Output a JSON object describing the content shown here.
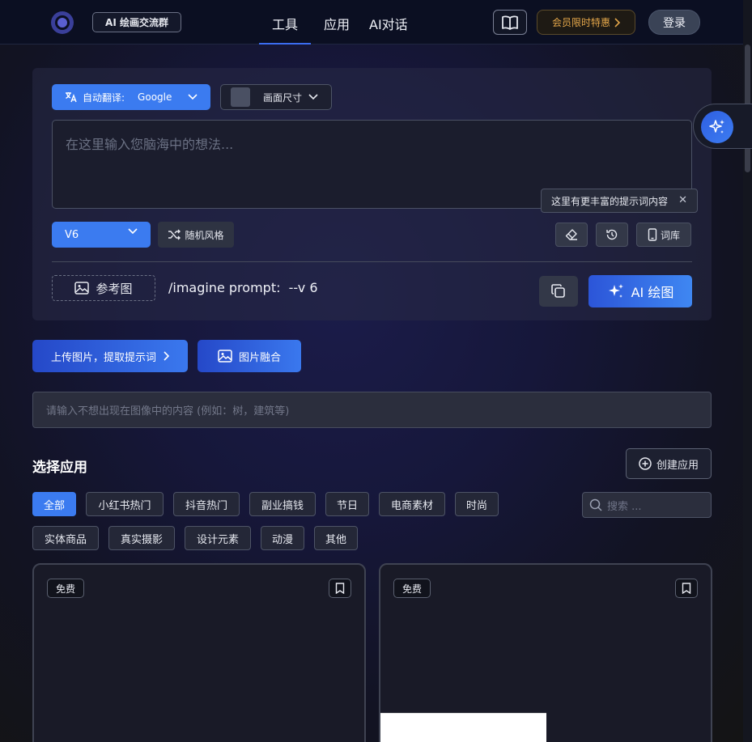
{
  "nav": {
    "group_label": "AI 绘画交流群",
    "links": [
      "工具",
      "应用",
      "AI对话"
    ],
    "vip_label": "会员限时特惠",
    "login_label": "登录"
  },
  "prompt_panel": {
    "translate_label": "自动翻译:",
    "translate_value": "Google",
    "size_label": "画面尺寸",
    "placeholder": "在这里输入您脑海中的想法...",
    "tooltip": "这里有更丰富的提示词内容",
    "model_value": "V6",
    "random_label": "随机风格",
    "lexicon_label": "词库",
    "reference_label": "参考图",
    "imagine_text": "/imagine prompt:  --v 6",
    "draw_label": "AI 绘图"
  },
  "upload": {
    "extract_label": "上传图片，提取提示词",
    "fuse_label": "图片融合"
  },
  "negative": {
    "placeholder": "请输入不想出现在图像中的内容 (例如：树，建筑等)"
  },
  "apps": {
    "title": "选择应用",
    "create_label": "创建应用",
    "search_placeholder": "搜索 ...",
    "chips_row1": [
      "全部",
      "小红书热门",
      "抖音热门",
      "副业搞钱",
      "节日",
      "电商素材",
      "时尚"
    ],
    "chips_row2": [
      "实体商品",
      "真实摄影",
      "设计元素",
      "动漫",
      "其他"
    ],
    "cards": [
      {
        "badge": "免费"
      },
      {
        "badge": "免费"
      }
    ]
  },
  "colors": {
    "accent": "#3b7bf0",
    "vip": "#e4a74a"
  }
}
